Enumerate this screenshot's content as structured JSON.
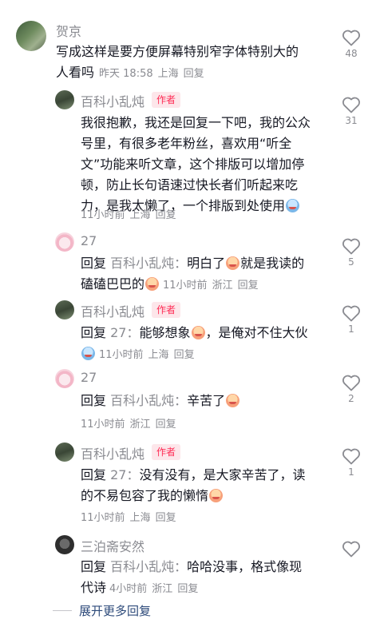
{
  "comment": {
    "author": "贺京",
    "line1": "写成这样是要方便屏幕特别窄字体特别大的",
    "line2": "人看吗",
    "time": "昨天 18:58",
    "location": "上海",
    "reply_label": "回复",
    "likes": "48"
  },
  "replies": [
    {
      "author": "百科小乱炖",
      "badge": "作者",
      "lines": [
        "我很抱歉，我还是回复一下吧，我的公众",
        "号里，有很多老年粉丝，喜欢用“听全",
        "文”功能来听文章，这个排版可以增加停",
        "顿，防止长句语速过快长者们听起来吃",
        "力，是我太懒了，一个排版到处使用"
      ],
      "time": "11小时前",
      "location": "上海",
      "reply_label": "回复",
      "likes": "31"
    },
    {
      "author": "27",
      "reply_kw": "回复",
      "reply_to": "百科小乱炖：",
      "line1_text": "明白了",
      "line1_tail": "就是我读的",
      "line2_text": "磕磕巴巴的",
      "time": "11小时前",
      "location": "浙江",
      "reply_label": "回复",
      "likes": "5"
    },
    {
      "author": "百科小乱炖",
      "badge": "作者",
      "reply_kw": "回复",
      "reply_to": "27：",
      "line1_text": "能够想象",
      "line1_tail": "，是俺对不住大伙",
      "time": "11小时前",
      "location": "上海",
      "reply_label": "回复",
      "likes": "1"
    },
    {
      "author": "27",
      "reply_kw": "回复",
      "reply_to": "百科小乱炖：",
      "line1_text": "辛苦了",
      "time": "11小时前",
      "location": "浙江",
      "reply_label": "回复",
      "likes": "2"
    },
    {
      "author": "百科小乱炖",
      "badge": "作者",
      "reply_kw": "回复",
      "reply_to": "27：",
      "line1_text": "没有没有，是大家辛苦了，读",
      "line2_text": "的不易包容了我的懒惰",
      "time": "11小时前",
      "location": "上海",
      "reply_label": "回复",
      "likes": "1"
    },
    {
      "author": "三泊斋安然",
      "reply_kw": "回复",
      "reply_to": "百科小乱炖：",
      "line1_text": "哈哈没事，格式像现",
      "line2_text": "代诗",
      "time": "4小时前",
      "location": "浙江",
      "reply_label": "回复"
    }
  ],
  "expand_more": "展开更多回复",
  "icons": {
    "like": "heart-outline-icon",
    "emoji": "emoji-icon"
  }
}
